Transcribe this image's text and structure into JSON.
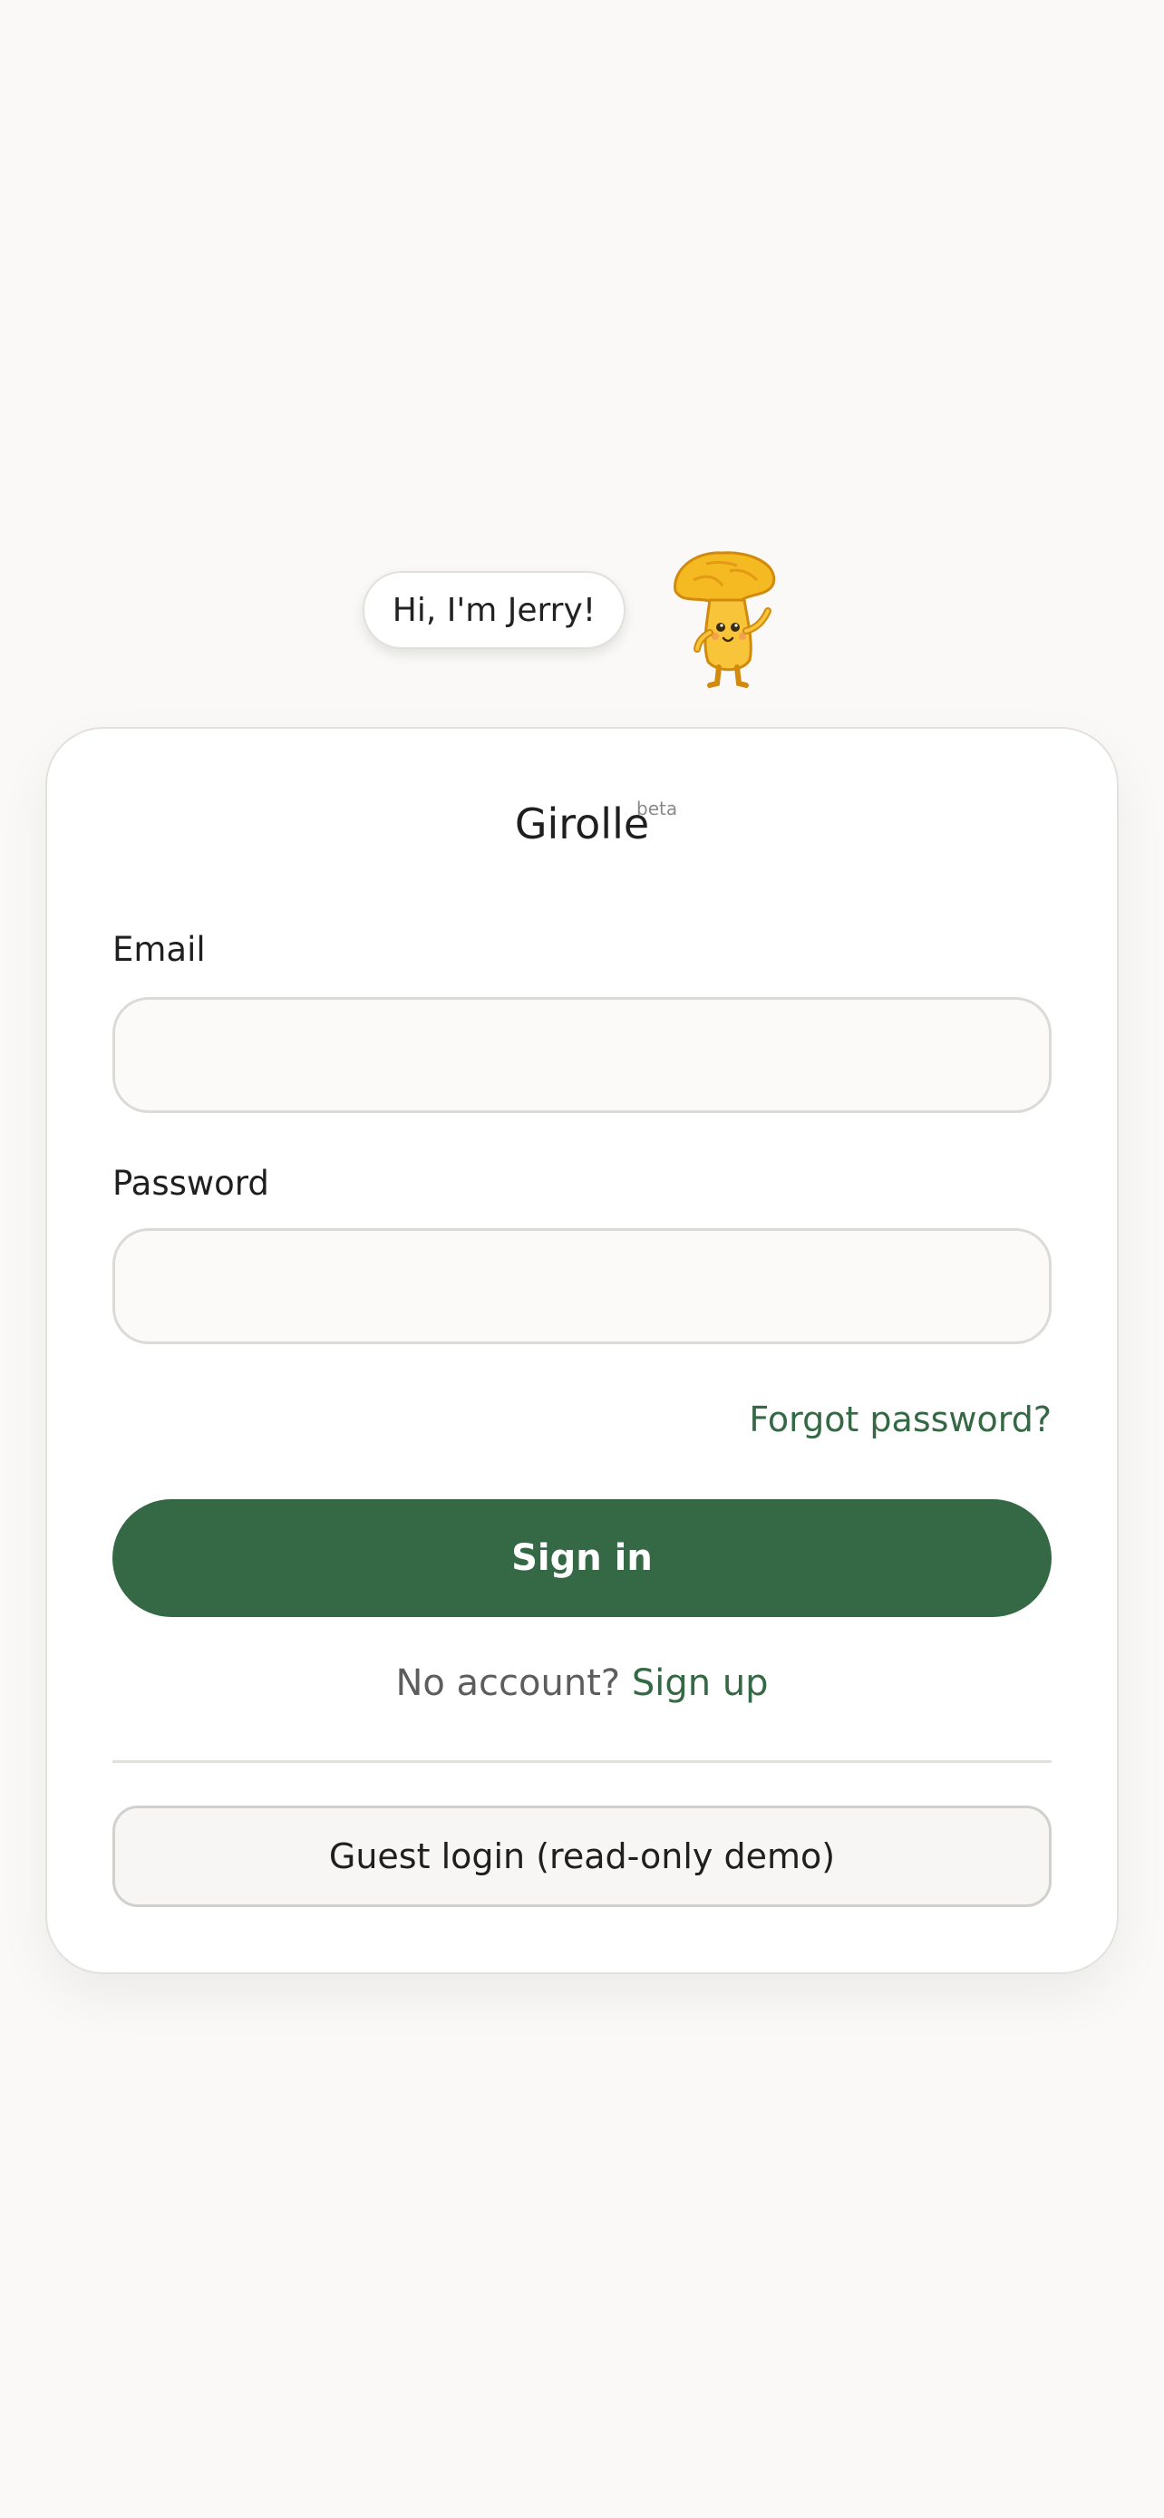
{
  "mascot": {
    "greeting": "Hi, I'm Jerry!",
    "icon": "chanterelle-mushroom-mascot-icon"
  },
  "brand": {
    "title": "Girolle",
    "badge": "beta"
  },
  "form": {
    "email_label": "Email",
    "email_value": "",
    "password_label": "Password",
    "password_value": "",
    "forgot_label": "Forgot password?",
    "signin_label": "Sign in",
    "no_account_text": "No account?",
    "signup_label": "Sign up",
    "guest_label": "Guest login (read-only demo)"
  },
  "colors": {
    "accent": "#356844",
    "background": "#faf9f7",
    "card": "#ffffff",
    "mascot": "#f5b921"
  }
}
